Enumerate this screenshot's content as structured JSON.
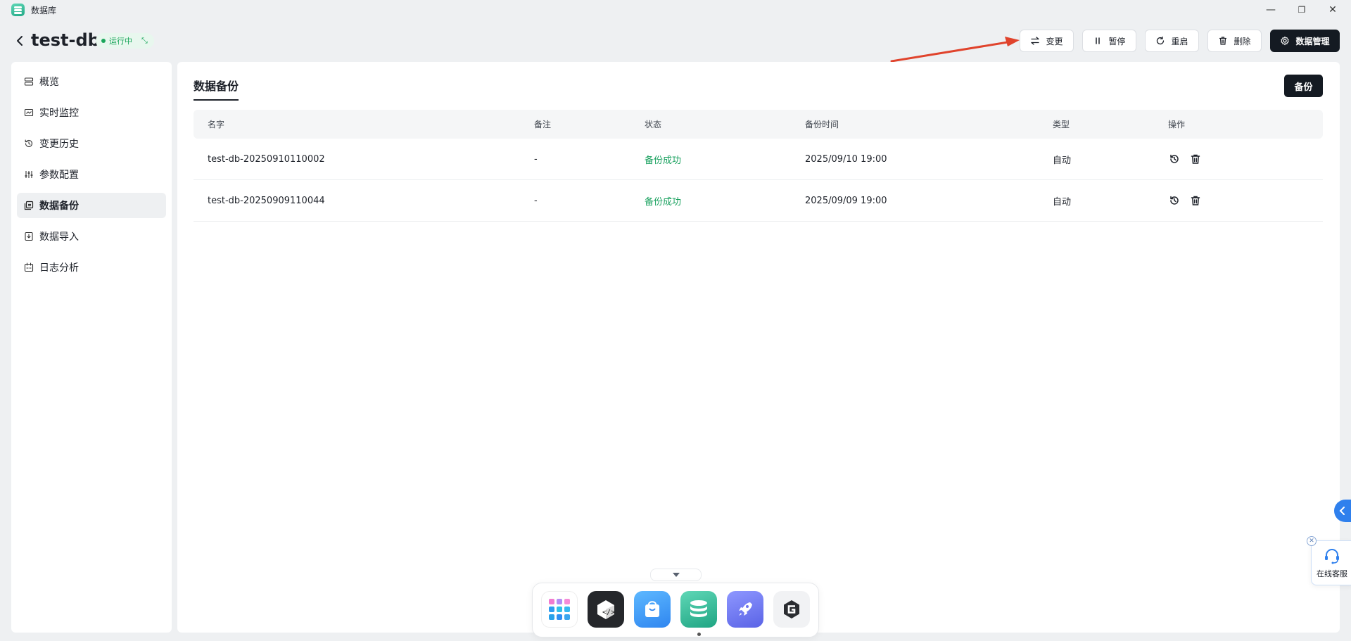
{
  "window": {
    "app_title": "数据库",
    "minimize": "—",
    "restore": "❐",
    "close": "✕"
  },
  "header": {
    "title": "test-db",
    "status": "运行中",
    "buttons": {
      "change": "变更",
      "pause": "暂停",
      "restart": "重启",
      "delete": "删除",
      "manage": "数据管理"
    }
  },
  "sidebar": {
    "items": [
      {
        "label": "概览",
        "icon": "server-icon"
      },
      {
        "label": "实时监控",
        "icon": "monitor-icon"
      },
      {
        "label": "变更历史",
        "icon": "history-icon"
      },
      {
        "label": "参数配置",
        "icon": "sliders-icon"
      },
      {
        "label": "数据备份",
        "icon": "backup-icon",
        "active": true
      },
      {
        "label": "数据导入",
        "icon": "import-icon"
      },
      {
        "label": "日志分析",
        "icon": "calendar-icon"
      }
    ]
  },
  "main": {
    "tab": "数据备份",
    "backup_button": "备份",
    "columns": {
      "name": "名字",
      "note": "备注",
      "status": "状态",
      "time": "备份时间",
      "type": "类型",
      "ops": "操作"
    },
    "rows": [
      {
        "name": "test-db-20250910110002",
        "note": "-",
        "status": "备份成功",
        "time": "2025/09/10 19:00",
        "type": "自动"
      },
      {
        "name": "test-db-20250909110044",
        "note": "-",
        "status": "备份成功",
        "time": "2025/09/09 19:00",
        "type": "自动"
      }
    ]
  },
  "support": {
    "label": "在线客服"
  },
  "colors": {
    "accent_dark": "#141a22",
    "success": "#17a05d",
    "annotation_arrow": "#e0432c"
  }
}
